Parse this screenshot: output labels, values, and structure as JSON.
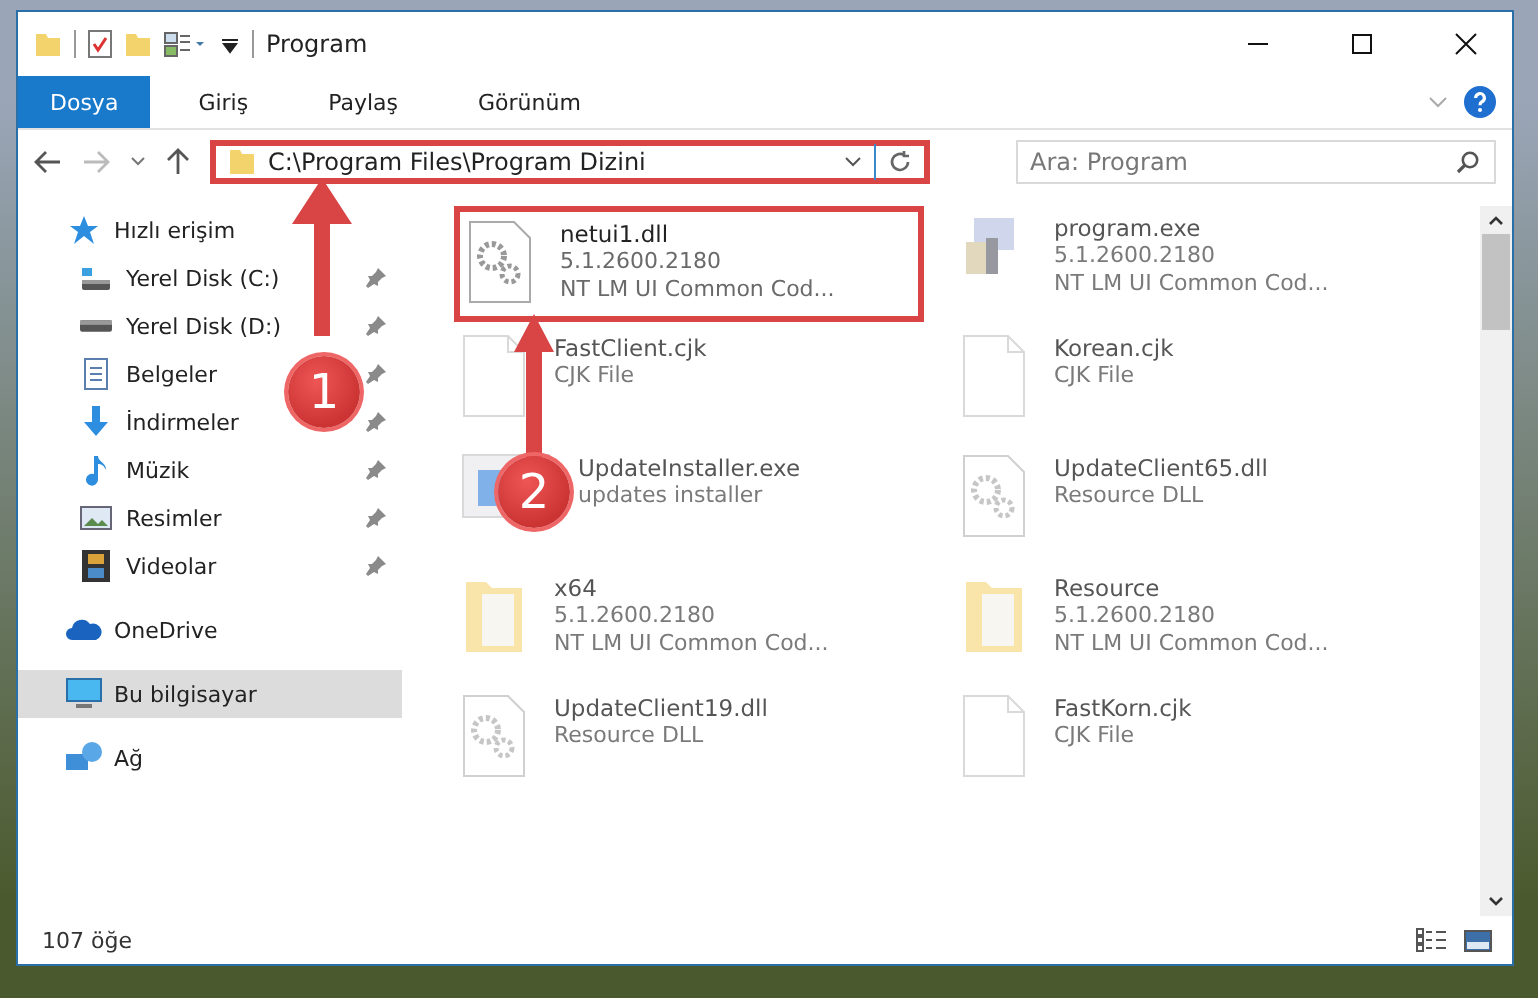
{
  "window": {
    "title": "Program"
  },
  "ribbon_tabs": [
    {
      "label": "Dosya",
      "selected": true
    },
    {
      "label": "Giriş",
      "selected": false
    },
    {
      "label": "Paylaş",
      "selected": false
    },
    {
      "label": "Görünüm",
      "selected": false
    }
  ],
  "address_bar": {
    "path": "C:\\Program Files\\Program Dizini",
    "highlighted": true
  },
  "search": {
    "placeholder": "Ara: Program"
  },
  "sidebar": {
    "items": [
      {
        "label": "Hızlı erişim",
        "kind": "star",
        "selected": false,
        "children": [
          {
            "label": "Yerel Disk (C:)",
            "kind": "drive-c",
            "selected": false,
            "pinned": true
          },
          {
            "label": "Yerel Disk (D:)",
            "kind": "drive",
            "selected": false,
            "pinned": true
          },
          {
            "label": "Belgeler",
            "kind": "docs",
            "selected": false,
            "pinned": true
          },
          {
            "label": "İndirmeler",
            "kind": "download",
            "selected": false,
            "pinned": true
          },
          {
            "label": "Müzik",
            "kind": "music",
            "selected": false,
            "pinned": true
          },
          {
            "label": "Resimler",
            "kind": "pictures",
            "selected": false,
            "pinned": true
          },
          {
            "label": "Videolar",
            "kind": "video",
            "selected": false,
            "pinned": true
          }
        ]
      },
      {
        "label": "OneDrive",
        "kind": "cloud",
        "selected": false
      },
      {
        "label": "Bu bilgisayar",
        "kind": "pc",
        "selected": true
      },
      {
        "label": "Ağ",
        "kind": "network",
        "selected": false
      }
    ]
  },
  "files": [
    {
      "name": "netui1.dll",
      "lines": [
        "5.1.2600.2180",
        "NT LM UI Common Cod..."
      ],
      "kind": "gear",
      "blurred": false,
      "highlighted": true
    },
    {
      "name": "program.exe",
      "lines": [
        "5.1.2600.2180",
        "NT LM UI Common Cod..."
      ],
      "kind": "exe",
      "blurred": true,
      "highlighted": false
    },
    {
      "name": "FastClient.cjk",
      "lines": [
        "CJK File"
      ],
      "kind": "doc",
      "blurred": true,
      "highlighted": false
    },
    {
      "name": "Korean.cjk",
      "lines": [
        "CJK File"
      ],
      "kind": "doc",
      "blurred": true,
      "highlighted": false
    },
    {
      "name": "UpdateInstaller.exe",
      "lines": [
        "updates installer"
      ],
      "kind": "installer",
      "blurred": true,
      "highlighted": false
    },
    {
      "name": "UpdateClient65.dll",
      "lines": [
        "Resource DLL"
      ],
      "kind": "dll",
      "blurred": true,
      "highlighted": false
    },
    {
      "name": "x64",
      "lines": [
        "5.1.2600.2180",
        "NT LM UI Common Cod..."
      ],
      "kind": "folder",
      "blurred": true,
      "highlighted": false
    },
    {
      "name": "Resource",
      "lines": [
        "5.1.2600.2180",
        "NT LM UI Common Cod..."
      ],
      "kind": "folder",
      "blurred": true,
      "highlighted": false
    },
    {
      "name": "UpdateClient19.dll",
      "lines": [
        "Resource DLL"
      ],
      "kind": "dll",
      "blurred": true,
      "highlighted": false
    },
    {
      "name": "FastKorn.cjk",
      "lines": [
        "CJK File"
      ],
      "kind": "doc",
      "blurred": true,
      "highlighted": false
    }
  ],
  "annotations": [
    {
      "number": "1"
    },
    {
      "number": "2"
    }
  ],
  "status_bar": {
    "count": "107 öğe"
  }
}
